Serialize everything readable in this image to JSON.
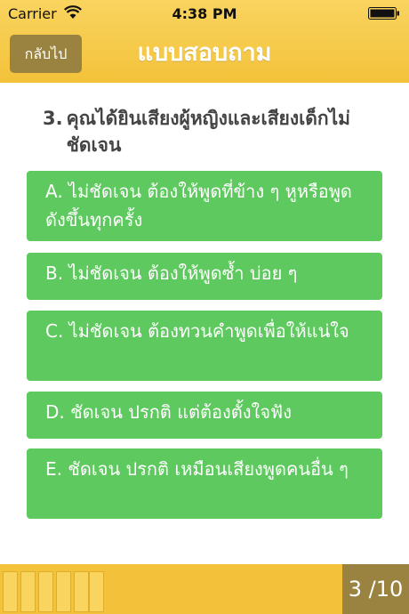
{
  "status_bar": {
    "carrier": "Carrier",
    "time": "4:38 PM"
  },
  "header": {
    "back_label": "กลับไป",
    "title": "แบบสอบถาม"
  },
  "question": {
    "number": "3.",
    "text": "คุณได้ยินเสียงผู้หญิงและเสียงเด็กไม่ชัดเจน"
  },
  "answers": [
    {
      "text": "A. ไม่ชัดเจน ต้องให้พูดที่ข้าง ๆ หูหรือพูดดังขึ้นทุกครั้ง"
    },
    {
      "text": "B. ไม่ชัดเจน ต้องให้พูดซ้ำ บ่อย ๆ"
    },
    {
      "text": "C. ไม่ชัดเจน ต้องทวนคำพูดเพื่อให้แน่ใจ"
    },
    {
      "text": "D. ชัดเจน ปรกติ แต่ต้องตั้งใจฟัง"
    },
    {
      "text": "E.  ชัดเจน ปรกติ เหมือนเสียงพูดคนอื่น ๆ"
    }
  ],
  "progress": {
    "counter": "3 /10",
    "current": 3,
    "total": 10
  },
  "colors": {
    "header": "#f3c23a",
    "answer": "#5ec95e",
    "accent_dark": "#9a8340"
  }
}
